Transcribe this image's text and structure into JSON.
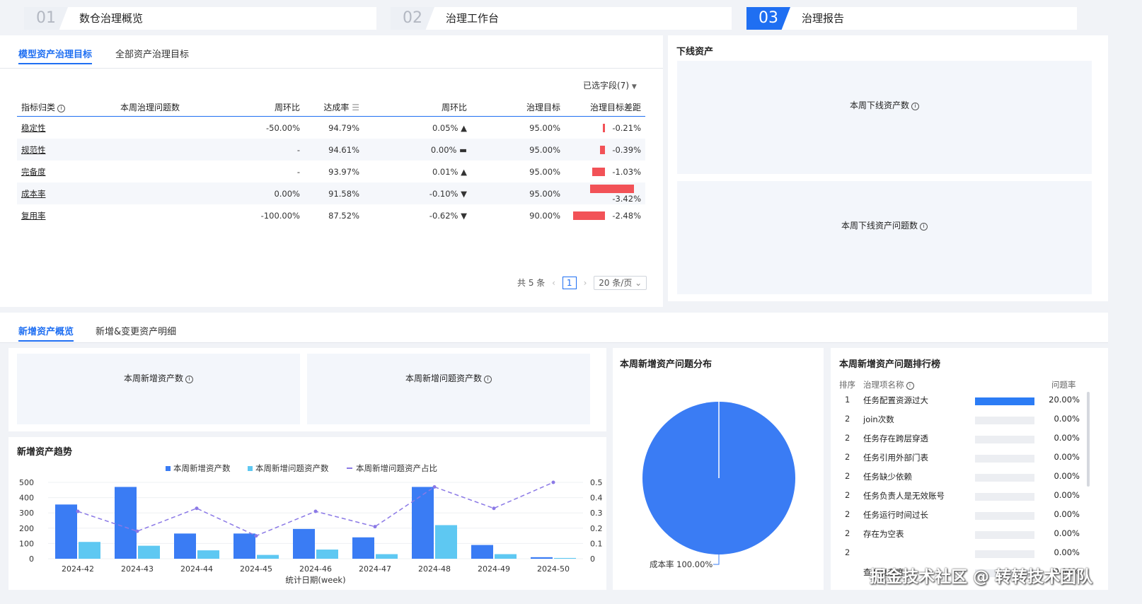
{
  "steps": [
    {
      "num": "01",
      "label": "数仓治理概览"
    },
    {
      "num": "02",
      "label": "治理工作台"
    },
    {
      "num": "03",
      "label": "治理报告"
    }
  ],
  "colors": {
    "accent": "#1f6ff2",
    "up": "#25b26a",
    "down": "#f0474b",
    "flat": "#f2c230",
    "bar_new": "#3a7cf4",
    "bar_issue": "#5ec8f2",
    "line": "#8b79e6"
  },
  "governance": {
    "tabs": [
      "模型资产治理目标",
      "全部资产治理目标"
    ],
    "field_selector": "已选字段(7)",
    "columns": [
      "指标归类",
      "本周治理问题数",
      "周环比",
      "达成率",
      "周环比",
      "治理目标",
      "治理目标差距"
    ],
    "rows": [
      {
        "category": "稳定性",
        "issues": "",
        "wow": "-50.00%",
        "rate": "94.79%",
        "rate_wow": "0.05%",
        "trend": "up",
        "target": "95.00%",
        "gap": "-0.21%",
        "gap_value": 0.21
      },
      {
        "category": "规范性",
        "issues": "",
        "wow": "-",
        "rate": "94.61%",
        "rate_wow": "0.00%",
        "trend": "flat",
        "target": "95.00%",
        "gap": "-0.39%",
        "gap_value": 0.39
      },
      {
        "category": "完备度",
        "issues": "",
        "wow": "-",
        "rate": "93.97%",
        "rate_wow": "0.01%",
        "trend": "up",
        "target": "95.00%",
        "gap": "-1.03%",
        "gap_value": 1.03
      },
      {
        "category": "成本率",
        "issues": "",
        "wow": "0.00%",
        "rate": "91.58%",
        "rate_wow": "-0.10%",
        "trend": "down",
        "target": "95.00%",
        "gap": "-3.42%",
        "gap_value": 3.42
      },
      {
        "category": "复用率",
        "issues": "",
        "wow": "-100.00%",
        "rate": "87.52%",
        "rate_wow": "-0.62%",
        "trend": "down",
        "target": "90.00%",
        "gap": "-2.48%",
        "gap_value": 2.48
      }
    ],
    "pager": {
      "total": "共 5 条",
      "page": "1",
      "page_size": "20 条/页"
    }
  },
  "offline": {
    "title": "下线资产",
    "card1": "本周下线资产数",
    "card2": "本周下线资产问题数"
  },
  "newassets": {
    "tabs": [
      "新增资产概览",
      "新增&变更资产明细"
    ],
    "card1": "本周新增资产数",
    "card2": "本周新增问题资产数",
    "trend_title": "新增资产趋势",
    "dist_title": "本周新增资产问题分布",
    "pie_label": "成本率 100.00%",
    "rank_title": "本周新增资产问题排行榜",
    "rank_headers": [
      "排序",
      "治理项名称",
      "问题率"
    ],
    "ranking": [
      {
        "n": "1",
        "name": "任务配置资源过大",
        "rate": "20.00%",
        "value": 20
      },
      {
        "n": "2",
        "name": "join次数",
        "rate": "0.00%",
        "value": 0
      },
      {
        "n": "2",
        "name": "任务存在跨层穿透",
        "rate": "0.00%",
        "value": 0
      },
      {
        "n": "2",
        "name": "任务引用外部门表",
        "rate": "0.00%",
        "value": 0
      },
      {
        "n": "2",
        "name": "任务缺少依赖",
        "rate": "0.00%",
        "value": 0
      },
      {
        "n": "2",
        "name": "任务负责人是无效账号",
        "rate": "0.00%",
        "value": 0
      },
      {
        "n": "2",
        "name": "任务运行时间过长",
        "rate": "0.00%",
        "value": 0
      },
      {
        "n": "2",
        "name": "存在为空表",
        "rate": "0.00%",
        "value": 0
      },
      {
        "n": "2",
        "name": "",
        "rate": "0.00%",
        "value": 0
      },
      {
        "n": "",
        "name": "查询复杂度",
        "rate": "0.00%",
        "value": 0
      }
    ],
    "watermark": "掘金技术社区 @ 转转技术团队"
  },
  "chart_data": {
    "type": "bar",
    "categories": [
      "2024-42",
      "2024-43",
      "2024-44",
      "2024-45",
      "2024-46",
      "2024-47",
      "2024-48",
      "2024-49",
      "2024-50"
    ],
    "xlabel": "统计日期(week)",
    "ylim": [
      0,
      500
    ],
    "y2lim": [
      0,
      0.5
    ],
    "yticks": [
      "0",
      "100",
      "200",
      "300",
      "400",
      "500"
    ],
    "y2ticks": [
      "0",
      "0.1",
      "0.2",
      "0.3",
      "0.4",
      "0.5"
    ],
    "series": [
      {
        "name": "本周新增资产数",
        "kind": "bar",
        "values": [
          355,
          470,
          165,
          165,
          195,
          140,
          470,
          90,
          10
        ]
      },
      {
        "name": "本周新增问题资产数",
        "kind": "bar",
        "values": [
          110,
          85,
          55,
          25,
          60,
          30,
          220,
          30,
          5
        ]
      },
      {
        "name": "本周新增问题资产占比",
        "kind": "line",
        "values": [
          0.31,
          0.18,
          0.33,
          0.15,
          0.31,
          0.21,
          0.47,
          0.33,
          0.5
        ]
      }
    ]
  }
}
